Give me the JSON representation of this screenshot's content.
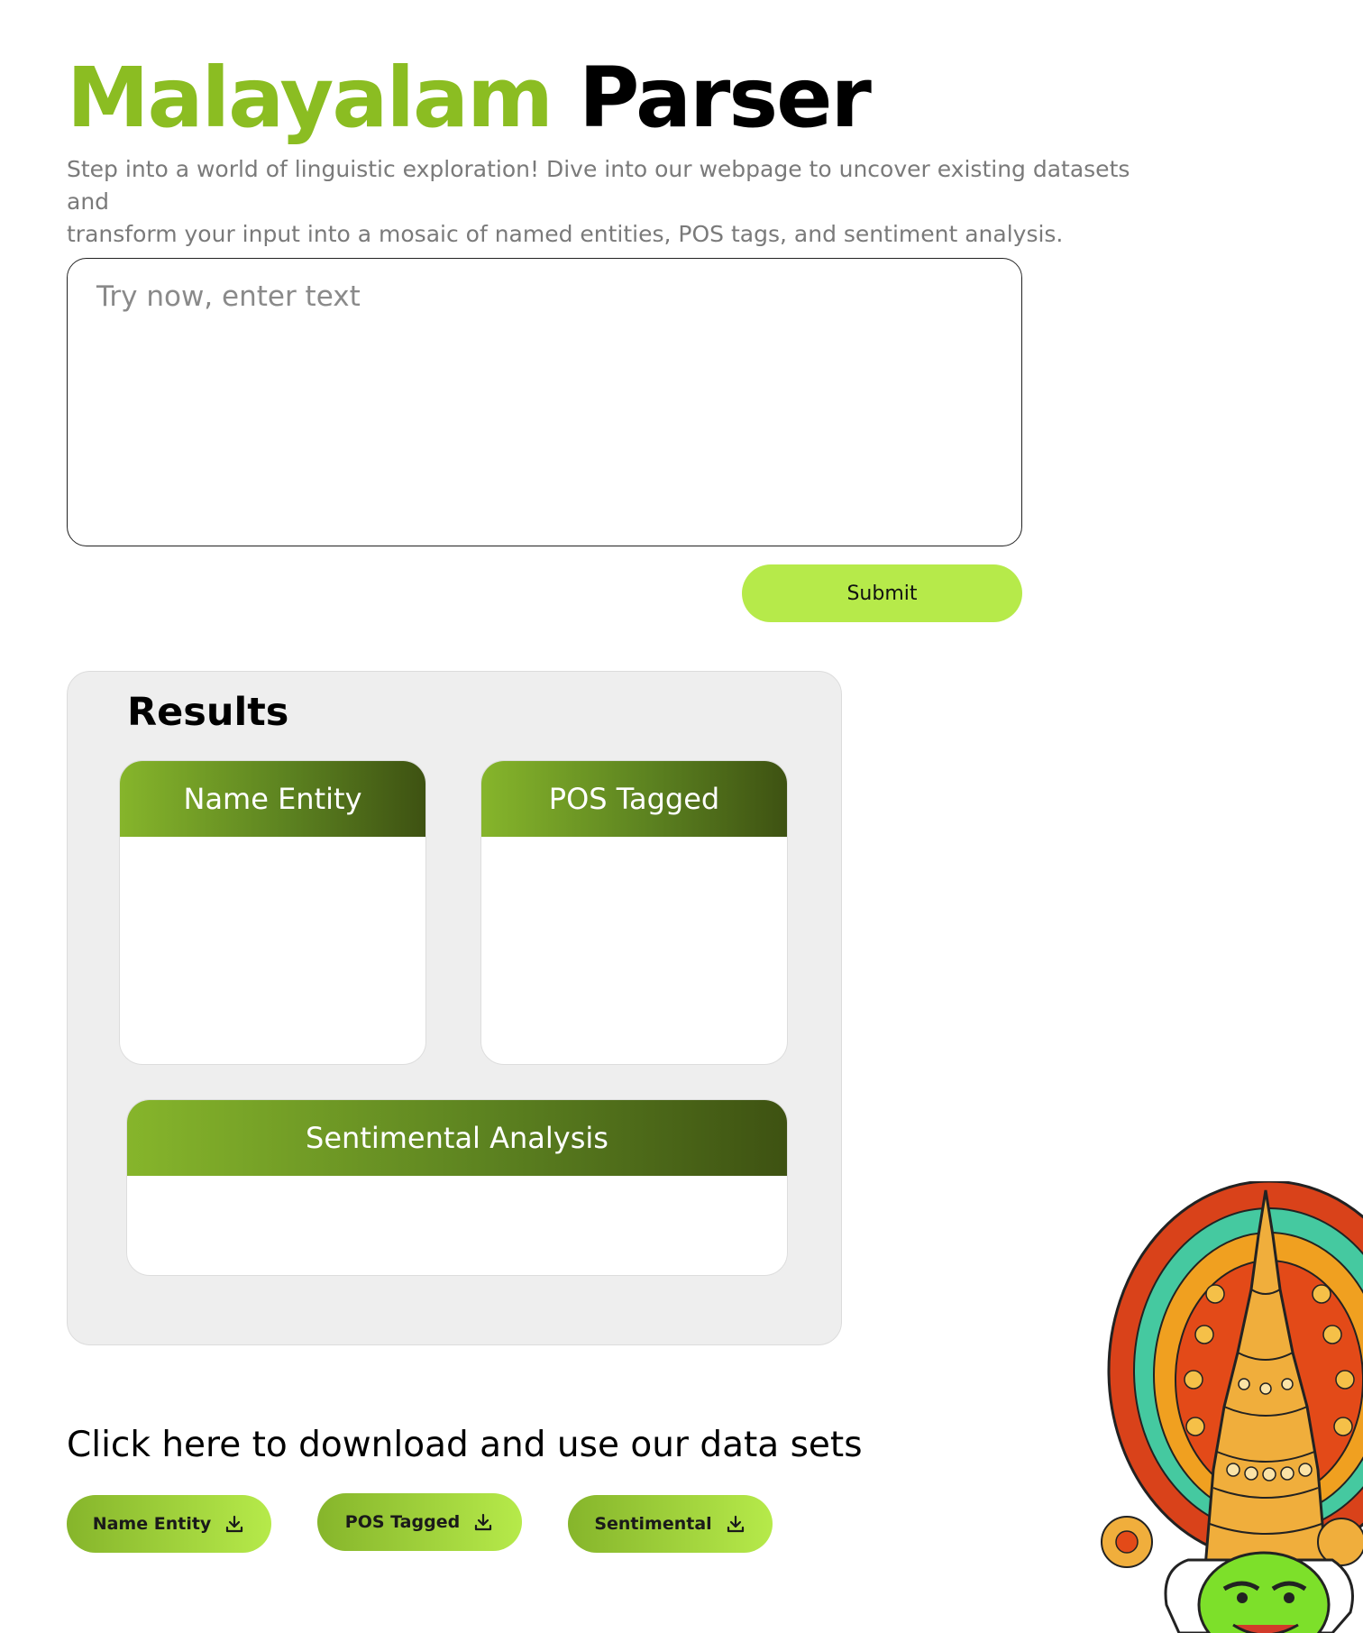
{
  "header": {
    "title_green": "Malayalam",
    "title_black": "Parser",
    "subtitle_line1": "Step into a world of linguistic exploration! Dive into our webpage to uncover existing datasets and",
    "subtitle_line2": "transform your input into a mosaic of named entities, POS tags, and sentiment analysis."
  },
  "input": {
    "placeholder": "Try now, enter text",
    "value": ""
  },
  "submit_label": "Submit",
  "results": {
    "title": "Results",
    "cards": {
      "name_entity": "Name Entity",
      "pos_tagged": "POS Tagged",
      "sentiment": "Sentimental Analysis"
    }
  },
  "downloads": {
    "heading": "Click here to download and use our data sets",
    "buttons": [
      "Name Entity",
      "POS Tagged",
      "Sentimental"
    ]
  },
  "colors": {
    "accent_green": "#8bbd22",
    "button_lime": "#b6ea4a",
    "card_gradient_start": "#86b52b",
    "card_gradient_end": "#3e5212",
    "panel_bg": "#eeeeee"
  },
  "icons": {
    "download": "download-icon",
    "illustration": "kathakali-face-illustration"
  }
}
